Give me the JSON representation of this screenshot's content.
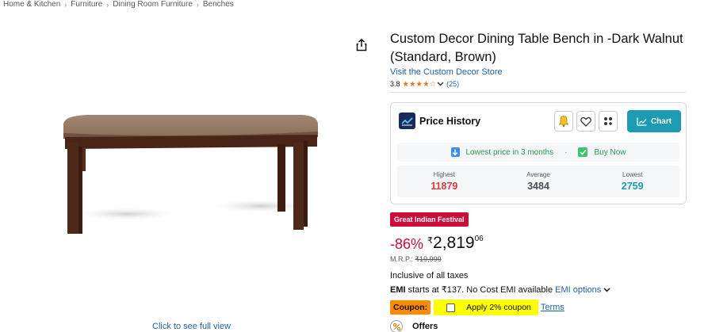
{
  "breadcrumb": [
    "Home & Kitchen",
    "Furniture",
    "Dining Room Furniture",
    "Benches"
  ],
  "breadcrumb_separator": "›",
  "product": {
    "title": "Custom Decor Dining Table Bench in -Dark Walnut (Standard, Brown)",
    "store_link": "Visit the Custom Decor Store",
    "rating": "3.8",
    "stars": "★★★★☆",
    "rating_count": "(25)",
    "full_view_link": "Click to see full view"
  },
  "price_history": {
    "title": "Price History",
    "chart_label": "Chart",
    "lowest_note": "Lowest price in 3 months",
    "separator": "·",
    "buy_now": "Buy Now",
    "stats": [
      {
        "label": "Highest",
        "value": "11879"
      },
      {
        "label": "Average",
        "value": "3484"
      },
      {
        "label": "Lowest",
        "value": "2759"
      }
    ],
    "currency_glyph": "",
    "colors": {
      "highest": "#e03a3a",
      "average": "#4a4f57",
      "lowest": "#1d9bb3",
      "chart_button": "#1d9bb3"
    }
  },
  "deal_badge": "Great Indian Festival",
  "price": {
    "discount": "-86%",
    "currency": "₹",
    "whole": "2,819",
    "fraction": "06",
    "mrp_label": "M.R.P.:",
    "mrp_value": "₹19,999"
  },
  "tax_note": "Inclusive of all taxes",
  "emi": {
    "label": "EMI",
    "text": " starts at ₹137. No Cost EMI available ",
    "link": "EMI options",
    "chevron": "⌄"
  },
  "coupon": {
    "label": "Coupon:",
    "text": "Apply 2% coupon",
    "terms": "Terms"
  },
  "offers": {
    "label": "Offers"
  },
  "icons": {
    "share": "share-icon",
    "bell": "bell-icon",
    "heart": "heart-icon",
    "grid": "grid-icon",
    "chart": "chart-icon"
  }
}
